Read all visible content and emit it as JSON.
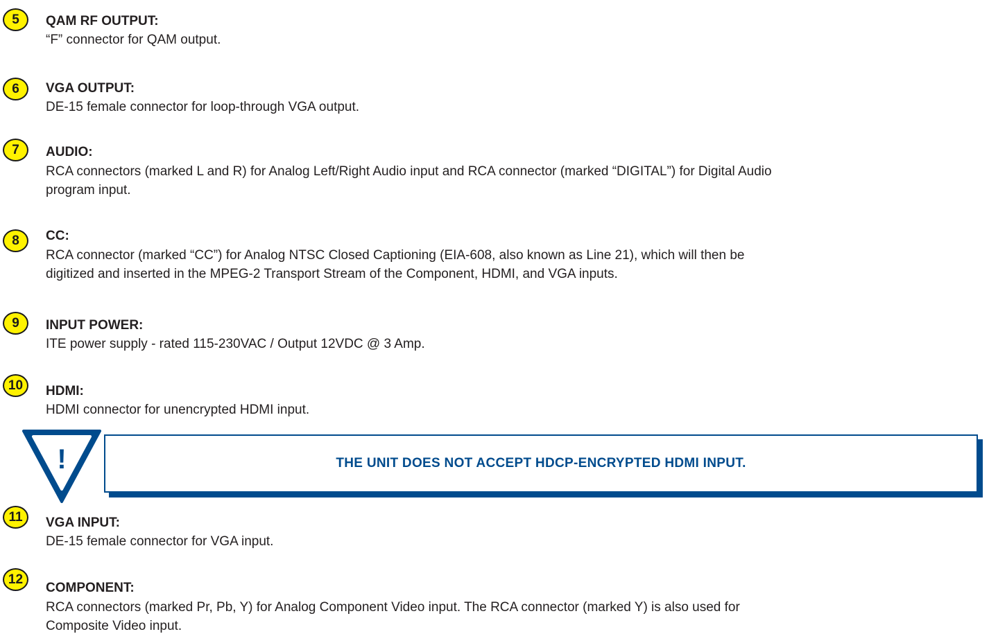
{
  "items": [
    {
      "number": "5",
      "title": "QAM RF OUTPUT:",
      "lines": [
        "“F” connector for QAM output."
      ]
    },
    {
      "number": "6",
      "title": "VGA OUTPUT:",
      "lines": [
        "DE-15 female connector for loop-through VGA output."
      ]
    },
    {
      "number": "7",
      "title": "AUDIO:",
      "lines": [
        "RCA connectors (marked L and R) for Analog Left/Right Audio input and RCA connector (marked “DIGITAL”) for Digital Audio",
        "program input."
      ]
    },
    {
      "number": "8",
      "title": "CC:",
      "lines": [
        "RCA connector (marked “CC”) for Analog NTSC Closed Captioning (EIA-608, also known as Line 21), which will then be",
        "digitized and inserted in the MPEG-2 Transport Stream of the Component, HDMI, and VGA inputs."
      ]
    },
    {
      "number": "9",
      "title": "INPUT POWER:",
      "lines": [
        "ITE power supply - rated 115-230VAC / Output 12VDC @ 3 Amp."
      ]
    },
    {
      "number": "10",
      "title": "HDMI:",
      "lines": [
        "HDMI connector for unencrypted HDMI input."
      ]
    },
    {
      "number": "11",
      "title": "VGA INPUT:",
      "lines": [
        "DE-15 female connector for VGA input."
      ]
    },
    {
      "number": "12",
      "title": "COMPONENT:",
      "lines": [
        "RCA connectors (marked Pr, Pb, Y) for Analog Component Video input. The RCA connector (marked Y) is also used for",
        "Composite Video input."
      ]
    }
  ],
  "warning": {
    "icon": "exclamation-warning-icon",
    "glyph": "!",
    "text": "THE UNIT DOES NOT ACCEPT HDCP-ENCRYPTED HDMI INPUT.",
    "color": "#004b8d"
  },
  "colors": {
    "badge_fill": "#fff200",
    "badge_border": "#1a1a1a",
    "text": "#231f20",
    "accent": "#004b8d"
  }
}
